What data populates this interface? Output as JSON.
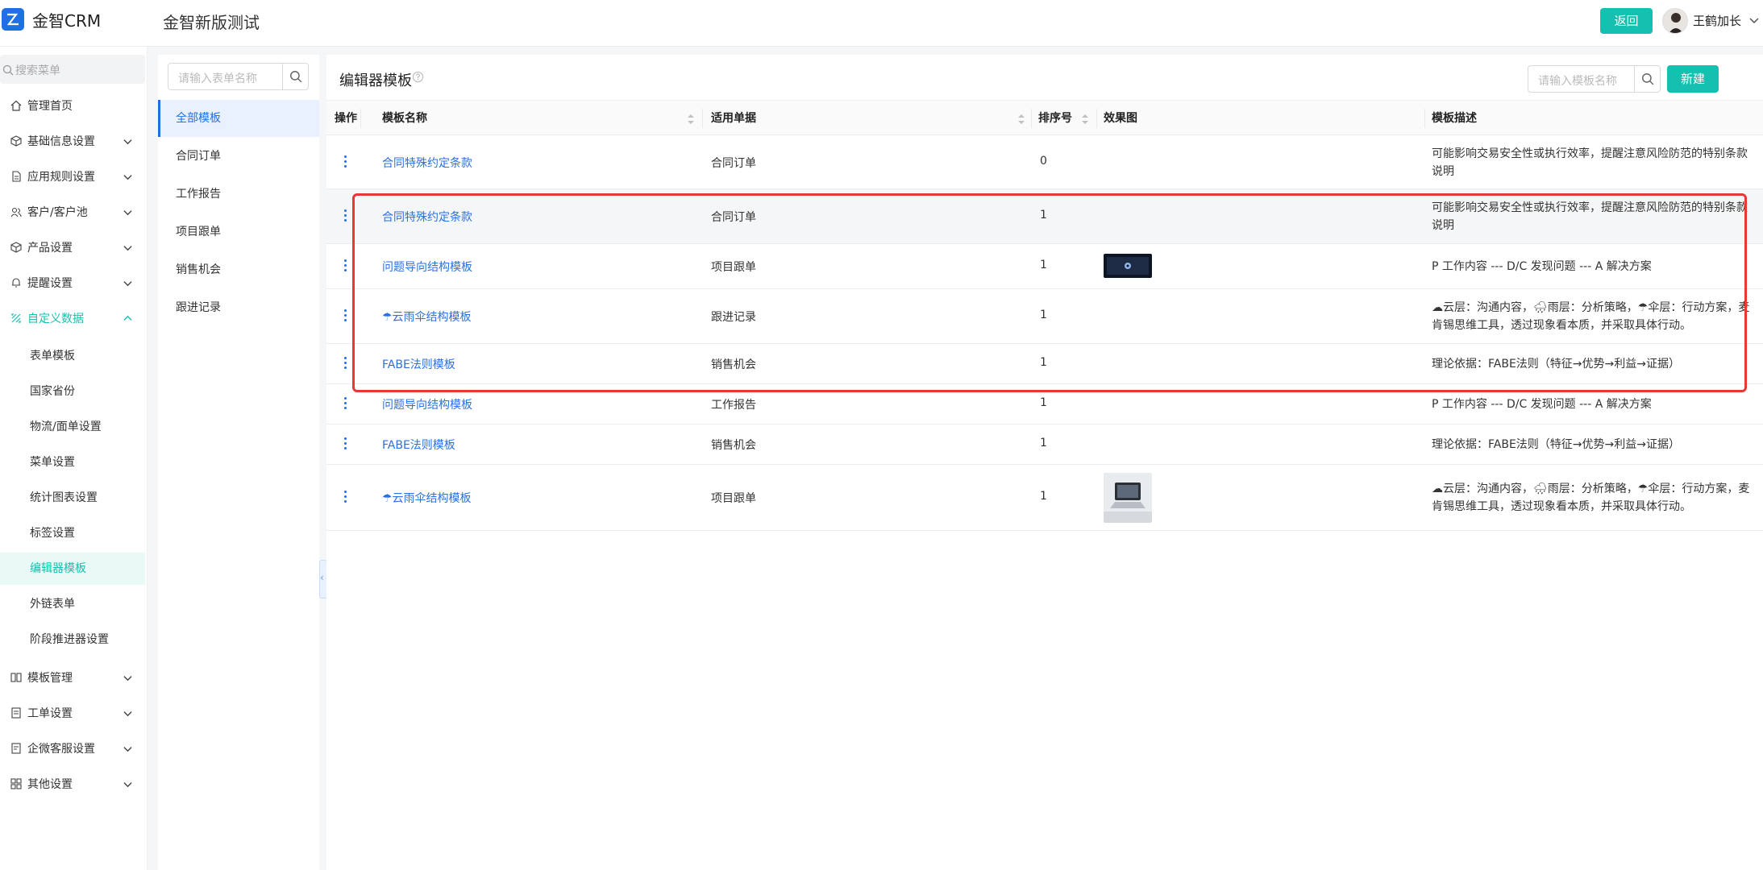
{
  "header": {
    "app_name": "金智CRM",
    "page_title": "金智新版测试",
    "back_label": "返回",
    "user_name": "王鹤加长"
  },
  "sidebar": {
    "search_placeholder": "搜索菜单",
    "items": [
      {
        "label": "管理首页",
        "icon": "home-icon"
      },
      {
        "label": "基础信息设置",
        "icon": "cube-icon"
      },
      {
        "label": "应用规则设置",
        "icon": "document-icon"
      },
      {
        "label": "客户/客户池",
        "icon": "users-icon"
      },
      {
        "label": "产品设置",
        "icon": "box-icon"
      },
      {
        "label": "提醒设置",
        "icon": "bell-icon"
      },
      {
        "label": "自定义数据",
        "icon": "custom-data-icon"
      }
    ],
    "submenu": [
      "表单模板",
      "国家省份",
      "物流/面单设置",
      "菜单设置",
      "统计图表设置",
      "标签设置",
      "编辑器模板",
      "外链表单",
      "阶段推进器设置"
    ],
    "items_bottom": [
      {
        "label": "模板管理",
        "icon": "template-icon"
      },
      {
        "label": "工单设置",
        "icon": "ticket-icon"
      },
      {
        "label": "企微客服设置",
        "icon": "service-icon"
      },
      {
        "label": "其他设置",
        "icon": "grid-icon"
      }
    ]
  },
  "categories": {
    "search_placeholder": "请输入表单名称",
    "items": [
      "全部模板",
      "合同订单",
      "工作报告",
      "项目跟单",
      "销售机会",
      "跟进记录"
    ]
  },
  "main": {
    "title": "编辑器模板",
    "search_placeholder": "请输入模板名称",
    "new_label": "新建",
    "columns": [
      "操作",
      "模板名称",
      "适用单据",
      "排序号",
      "效果图",
      "模板描述"
    ],
    "rows": [
      {
        "name": "合同特殊约定条款",
        "doc": "合同订单",
        "order": "0",
        "desc": "可能影响交易安全性或执行效率，提醒注意风险防范的特别条款说明"
      },
      {
        "name": "合同特殊约定条款",
        "doc": "合同订单",
        "order": "1",
        "desc": "可能影响交易安全性或执行效率，提醒注意风险防范的特别条款说明"
      },
      {
        "name": "问题导向结构模板",
        "doc": "项目跟单",
        "order": "1",
        "desc": "P 工作内容 --- D/C 发现问题 --- A 解决方案"
      },
      {
        "name": "☂云雨伞结构模板",
        "doc": "跟进记录",
        "order": "1",
        "desc": "☁云层：沟通内容，🌧雨层：分析策略，☂伞层：行动方案，麦肯锡思维工具，透过现象看本质，并采取具体行动。"
      },
      {
        "name": "FABE法则模板",
        "doc": "销售机会",
        "order": "1",
        "desc": "理论依据：FABE法则（特征→优势→利益→证据）"
      },
      {
        "name": "问题导向结构模板",
        "doc": "工作报告",
        "order": "1",
        "desc": "P 工作内容 --- D/C 发现问题 --- A 解决方案"
      },
      {
        "name": "FABE法则模板",
        "doc": "销售机会",
        "order": "1",
        "desc": "理论依据：FABE法则（特征→优势→利益→证据）"
      },
      {
        "name": "☂云雨伞结构模板",
        "doc": "项目跟单",
        "order": "1",
        "desc": "☁云层：沟通内容，🌧雨层：分析策略，☂伞层：行动方案，麦肯锡思维工具，透过现象看本质，并采取具体行动。"
      }
    ]
  },
  "colors": {
    "accent": "#15c0b0",
    "link": "#2b70e4",
    "highlight": "#e53935"
  }
}
